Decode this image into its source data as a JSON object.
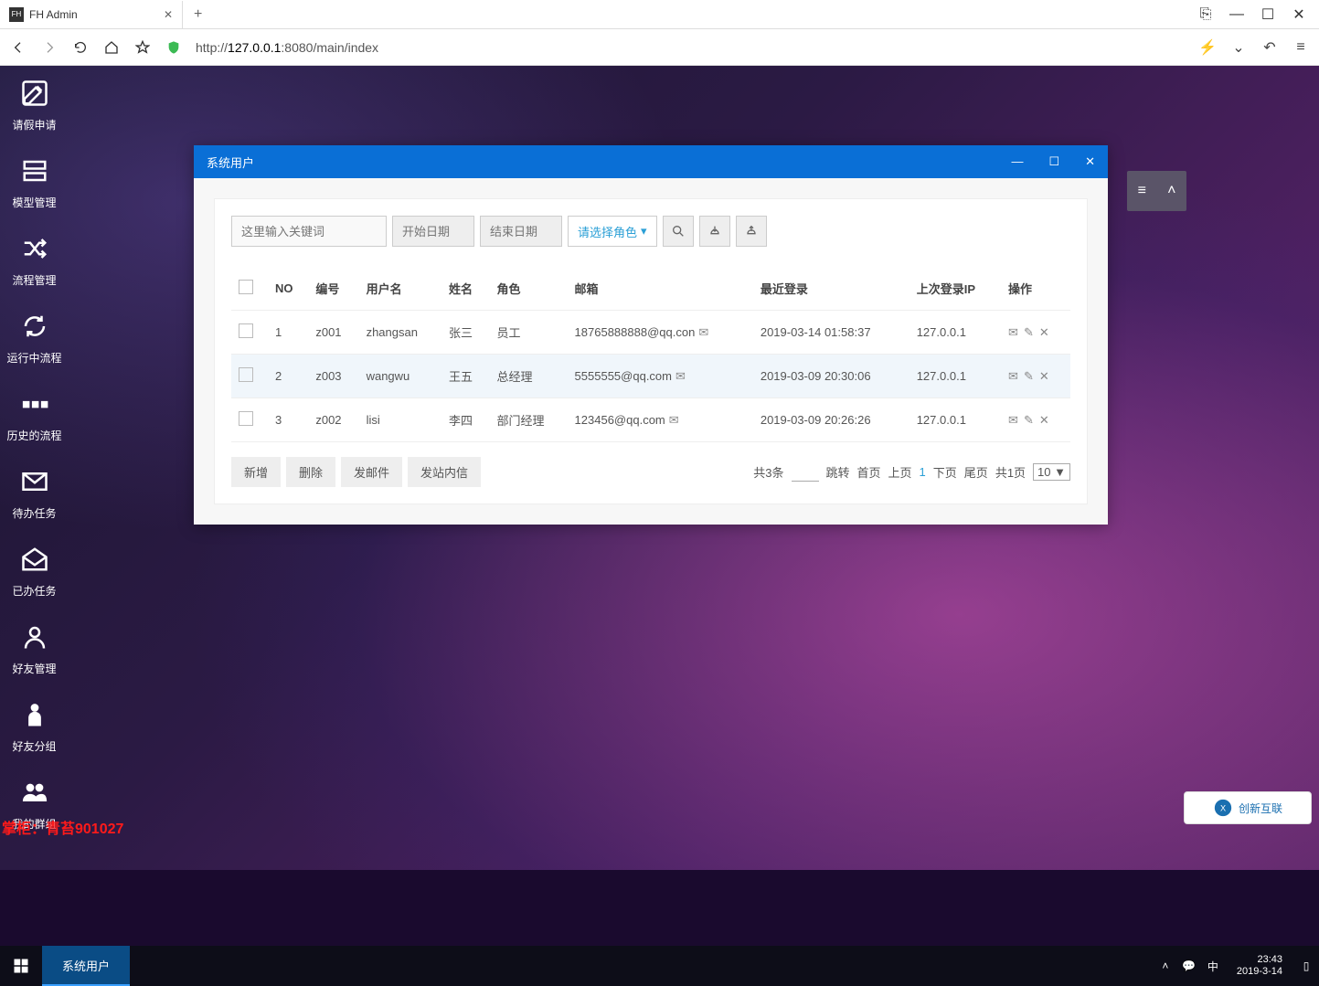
{
  "browser": {
    "tab_title": "FH Admin",
    "url_prefix": "http://",
    "url_host": "127.0.0.1",
    "url_port": ":8080",
    "url_path": "/main/index"
  },
  "sidebar": {
    "items": [
      {
        "label": "请假申请"
      },
      {
        "label": "模型管理"
      },
      {
        "label": "流程管理"
      },
      {
        "label": "运行中流程"
      },
      {
        "label": "历史的流程"
      },
      {
        "label": "待办任务"
      },
      {
        "label": "已办任务"
      },
      {
        "label": "好友管理"
      },
      {
        "label": "好友分组"
      },
      {
        "label": "我的群组"
      }
    ]
  },
  "overlay_text": "掌柜：青苔901027",
  "dialog": {
    "title": "系统用户",
    "filter": {
      "keyword_placeholder": "这里输入关键词",
      "start_date_placeholder": "开始日期",
      "end_date_placeholder": "结束日期",
      "role_placeholder": "请选择角色"
    },
    "headers": {
      "no": "NO",
      "code": "编号",
      "username": "用户名",
      "name": "姓名",
      "role": "角色",
      "email": "邮箱",
      "last_login": "最近登录",
      "last_ip": "上次登录IP",
      "ops": "操作"
    },
    "rows": [
      {
        "no": "1",
        "code": "z001",
        "username": "zhangsan",
        "name": "张三",
        "role": "员工",
        "email": "18765888888@qq.con",
        "last_login": "2019-03-14 01:58:37",
        "ip": "127.0.0.1"
      },
      {
        "no": "2",
        "code": "z003",
        "username": "wangwu",
        "name": "王五",
        "role": "总经理",
        "email": "5555555@qq.com",
        "last_login": "2019-03-09 20:30:06",
        "ip": "127.0.0.1"
      },
      {
        "no": "3",
        "code": "z002",
        "username": "lisi",
        "name": "李四",
        "role": "部门经理",
        "email": "123456@qq.com",
        "last_login": "2019-03-09 20:26:26",
        "ip": "127.0.0.1"
      }
    ],
    "buttons": {
      "add": "新增",
      "delete": "删除",
      "send_mail": "发邮件",
      "send_msg": "发站内信"
    },
    "pagination": {
      "total": "共3条",
      "jump": "跳转",
      "first": "首页",
      "prev": "上页",
      "current": "1",
      "next": "下页",
      "last": "尾页",
      "pages": "共1页",
      "size": "10"
    }
  },
  "taskbar": {
    "app": "系统用户",
    "time": "23:43",
    "date": "2019-3-14"
  },
  "watermark": "创新互联"
}
